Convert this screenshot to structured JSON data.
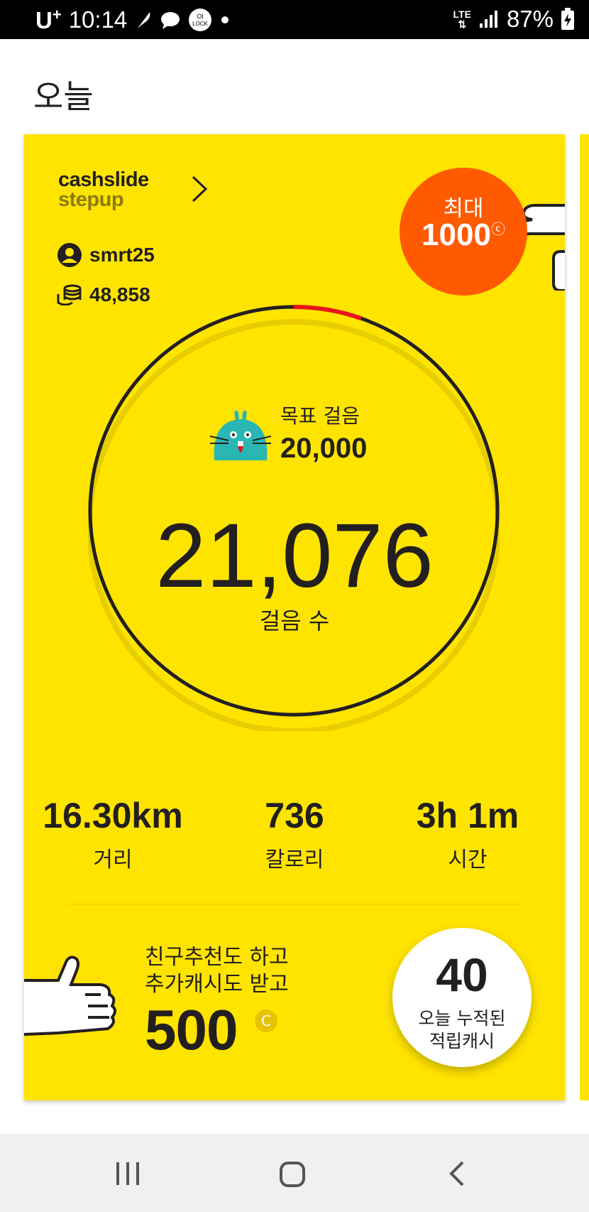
{
  "status_bar": {
    "carrier": "U",
    "carrier_sup": "+",
    "time": "10:14",
    "network": "LTE",
    "battery": "87%"
  },
  "page": {
    "title": "오늘"
  },
  "card": {
    "brand_line1": "cashslide",
    "brand_line2": "stepup",
    "username": "smrt25",
    "coins": "48,858",
    "max_badge": {
      "label": "최대",
      "amount": "1000",
      "unit": "C"
    },
    "goal": {
      "label": "목표 걸음",
      "value": "20,000"
    },
    "steps": {
      "value": "21,076",
      "label": "걸음 수"
    },
    "stats": [
      {
        "value": "16.30km",
        "label": "거리"
      },
      {
        "value": "736",
        "label": "칼로리"
      },
      {
        "value": "3h 1m",
        "label": "시간"
      }
    ],
    "promo": {
      "line1": "친구추천도 하고",
      "line2": "추가캐시도 받고",
      "amount": "500",
      "unit": "C"
    },
    "today": {
      "value": "40",
      "line1": "오늘 누적된",
      "line2": "적립캐시"
    }
  },
  "colors": {
    "card": "#ffe400",
    "badge": "#ff5a00",
    "progress": "#e8131b"
  }
}
